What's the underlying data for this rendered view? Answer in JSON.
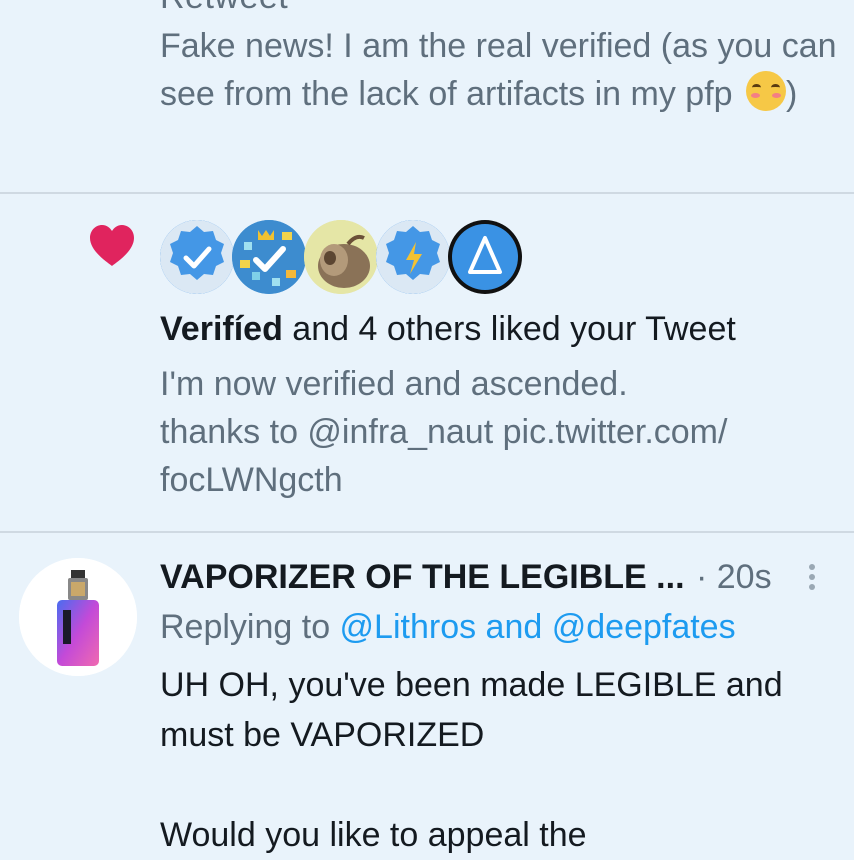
{
  "notification1": {
    "cut_title": "Retweet",
    "text": "Fake news!  I am the real verified (as you can see from the lack of artifacts in my pfp ",
    "text_end": ")"
  },
  "notification2": {
    "avatars": [
      "verified-badge-avatar",
      "verified-mosaic-avatar",
      "highland-cow-avatar",
      "lightning-badge-avatar",
      "delta-avatar"
    ],
    "liker_name": "Verifíed",
    "liked_text": " and 4 others liked your Tweet",
    "tweet_lines": [
      "I'm now verified and ascended.",
      "thanks to @infra_naut pic.twitter.com/",
      "focLWNgcth"
    ]
  },
  "notification3": {
    "author": "VAPORIZER OF THE LEGIBLE ...",
    "time": "· 20s",
    "replying_prefix": "Replying to ",
    "replying_handles": "@Lithros and @deepfates",
    "body_lines": [
      "UH OH, you've been made LEGIBLE and",
      "must be VAPORIZED",
      "",
      "Would you like to appeal the"
    ]
  },
  "colors": {
    "background": "#e9f3fb",
    "muted": "#5f6f7d",
    "link": "#1d9bf0",
    "heart": "#e0245e",
    "separator": "#cfd9e2"
  }
}
